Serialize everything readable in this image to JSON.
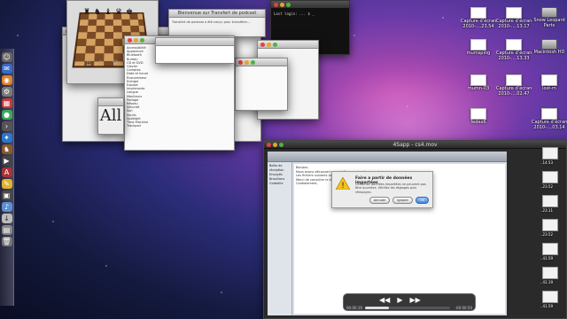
{
  "desktop": {
    "icons": [
      {
        "label": "Capture d’écran",
        "sub": "2010-....23.54",
        "kind": "screenshot"
      },
      {
        "label": "Capture d’écran",
        "sub": "2010-....13.17",
        "kind": "screenshot"
      },
      {
        "label": "Snow Leopard",
        "sub": "Parts",
        "kind": "disk"
      },
      {
        "label": "mumsping",
        "sub": "",
        "kind": "screenshot"
      },
      {
        "label": "Capture d’écran",
        "sub": "2010-....13.33",
        "kind": "screenshot"
      },
      {
        "label": "Macintosh HD",
        "sub": "",
        "kind": "disk"
      },
      {
        "label": "mumn-03",
        "sub": "",
        "kind": "screenshot"
      },
      {
        "label": "Capture d’écran",
        "sub": "2010-....02.47",
        "kind": "screenshot"
      },
      {
        "label": "lost-m",
        "sub": "",
        "kind": "screenshot"
      },
      {
        "label": "fedex6",
        "sub": "",
        "kind": "screenshot"
      },
      {
        "label": "Capture d’écran",
        "sub": "2010-....03.14",
        "kind": "screenshot"
      }
    ],
    "strip_labels": [
      "..14.53",
      "..23.52",
      "..23.11",
      "..23.52",
      "..41.59",
      "..41.19",
      "..41.59"
    ]
  },
  "windows": {
    "sheet_title": "Bienvenue sur Transfert de podcast",
    "sheet_text": "Transfert de podcast a été conçu pour transférer...",
    "prefs_items": [
      "Accessibilité",
      "Apparence",
      "Bluetooth",
      "Bureau",
      "CD et DVD",
      "Clavier",
      "Comptes",
      "Date et heure",
      "Économiseur",
      "Energie",
      "Expose",
      "Imprimante",
      "Langue",
      "Moniteurs",
      "Partage",
      "Réseau",
      "Sécurité",
      "Son",
      "Souris",
      "Spotlight",
      "Time Machine",
      "Trackpad"
    ],
    "terminal_text": "Last login: ...\n$ _",
    "font_book_sample": "All"
  },
  "video": {
    "title": "4Sapp - cs4.mov",
    "time_elapsed": "00:00:19",
    "time_remaining": "-00:00:50",
    "progress": 0.28
  },
  "mail": {
    "sidebar": [
      "Boîte de réception",
      "Envoyés",
      "Brouillons",
      "Corbeille"
    ],
    "body_lines": [
      "Bonjour,",
      "Nous avons découvert un problème avec votre compte.",
      "Les fichiers suivants ne sont pas compatibles.",
      "Merci de consulter le document joint.",
      "Cordialement,"
    ]
  },
  "dialog": {
    "title": "Faire a partir de données importées",
    "text": "Certaines données importées ne peuvent pas être ouvertes. Vérifiez les réglages puis réessayez.",
    "btn_cancel": "Annuler",
    "btn_other": "Ignorer",
    "btn_ok": "OK"
  },
  "colors": {
    "dock_tint": "#2a2a3c",
    "wallpaper_glow": "#d46ad0"
  }
}
